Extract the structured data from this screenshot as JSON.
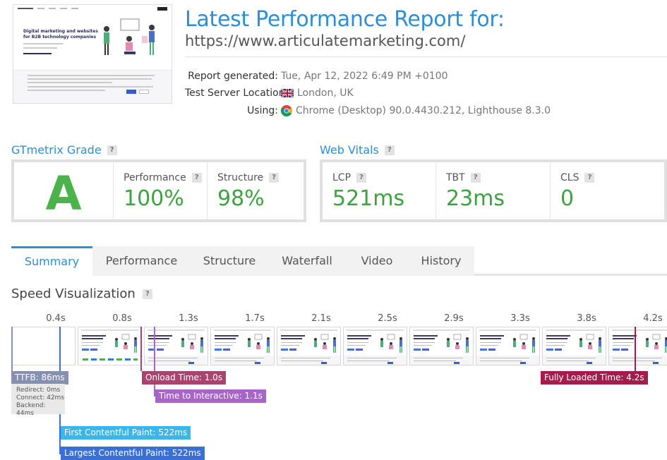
{
  "header": {
    "title": "Latest Performance Report for:",
    "url": "https://www.articulatemarketing.com/",
    "meta": [
      {
        "key": "Report generated:",
        "value": "Tue, Apr 12, 2022 6:49 PM +0100",
        "icon": ""
      },
      {
        "key": "Test Server Location:",
        "value": "London, UK",
        "icon": "uk-flag-icon"
      },
      {
        "key": "Using:",
        "value": "Chrome (Desktop) 90.0.4430.212, Lighthouse 8.3.0",
        "icon": "chrome-icon"
      }
    ]
  },
  "thumbnail": {
    "headline": "Digital marketing and websites for B2B technology companies"
  },
  "gtmetrix": {
    "label": "GTmetrix Grade",
    "grade": "A",
    "performance_label": "Performance",
    "performance_value": "100%",
    "structure_label": "Structure",
    "structure_value": "98%"
  },
  "web_vitals": {
    "label": "Web Vitals",
    "items": [
      {
        "label": "LCP",
        "value": "521ms"
      },
      {
        "label": "TBT",
        "value": "23ms"
      },
      {
        "label": "CLS",
        "value": "0"
      }
    ]
  },
  "tabs": [
    "Summary",
    "Performance",
    "Structure",
    "Waterfall",
    "Video",
    "History"
  ],
  "active_tab": "Summary",
  "speed_viz": {
    "title": "Speed Visualization",
    "times": [
      "0.4s",
      "0.8s",
      "1.3s",
      "1.7s",
      "2.1s",
      "2.5s",
      "2.9s",
      "3.3s",
      "3.8s",
      "4.2s"
    ],
    "ttfb": "TTFB: 86ms",
    "redirect": "Redirect: 0ms",
    "connect": "Connect: 42ms",
    "backend": "Backend: 44ms",
    "onload": "Onload Time: 1.0s",
    "tti": "Time to Interactive: 1.1s",
    "fcp": "First Contentful Paint: 522ms",
    "lcp": "Largest Contentful Paint: 522ms",
    "fully_loaded": "Fully Loaded Time: 4.2s"
  },
  "colors": {
    "accent": "#2b8fd8",
    "good": "#3fa142",
    "ttfb": "#8790b3",
    "onload": "#a8446f",
    "tti": "#a765c9",
    "fcp": "#3cb6e8",
    "lcp": "#3a6fd4",
    "fully_loaded": "#a41c4b"
  }
}
